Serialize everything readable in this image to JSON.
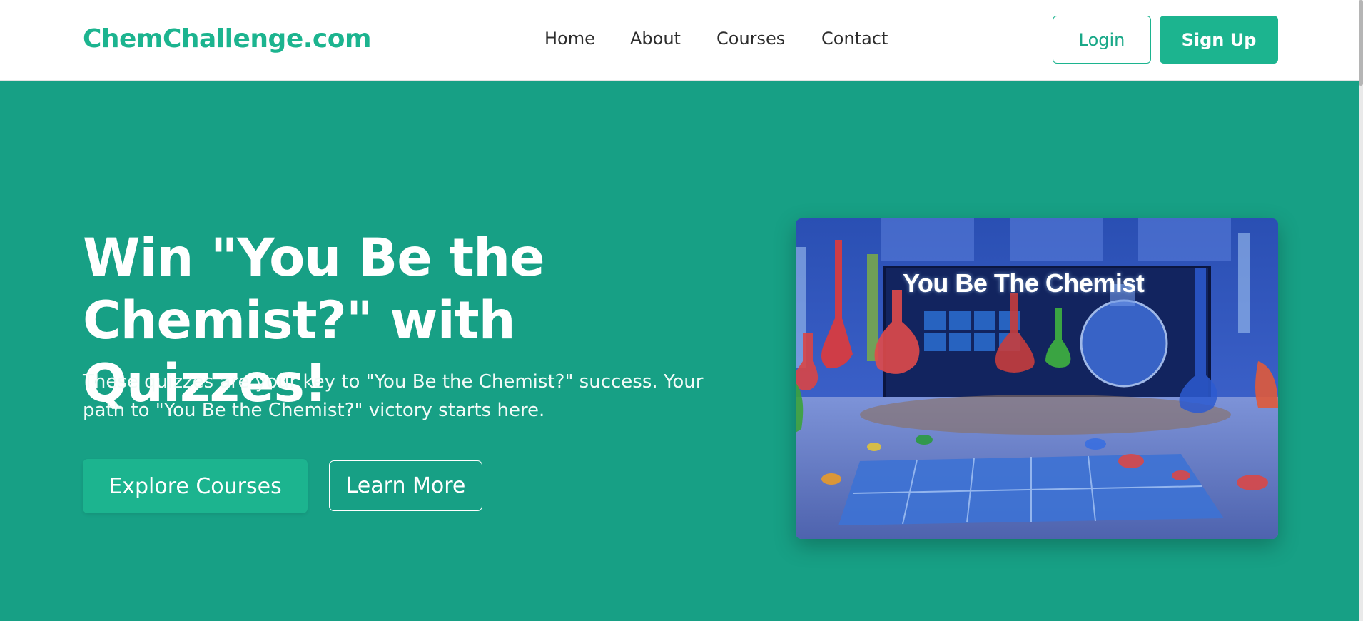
{
  "header": {
    "logo": "ChemChallenge.com",
    "nav": [
      "Home",
      "About",
      "Courses",
      "Contact"
    ],
    "login_label": "Login",
    "signup_label": "Sign Up"
  },
  "hero": {
    "title": "Win \"You Be the Chemist?\" with Quizzes!",
    "subtitle": "These quizzes are your key to \"You Be the Chemist?\" success. Your path to \"You Be the Chemist?\" victory starts here.",
    "primary_button": "Explore Courses",
    "secondary_button": "Learn More",
    "image_caption": "You Be The Chemist"
  },
  "colors": {
    "brand": "#1cb48f",
    "hero_bg": "#17a085",
    "header_bg": "#ffffff"
  }
}
